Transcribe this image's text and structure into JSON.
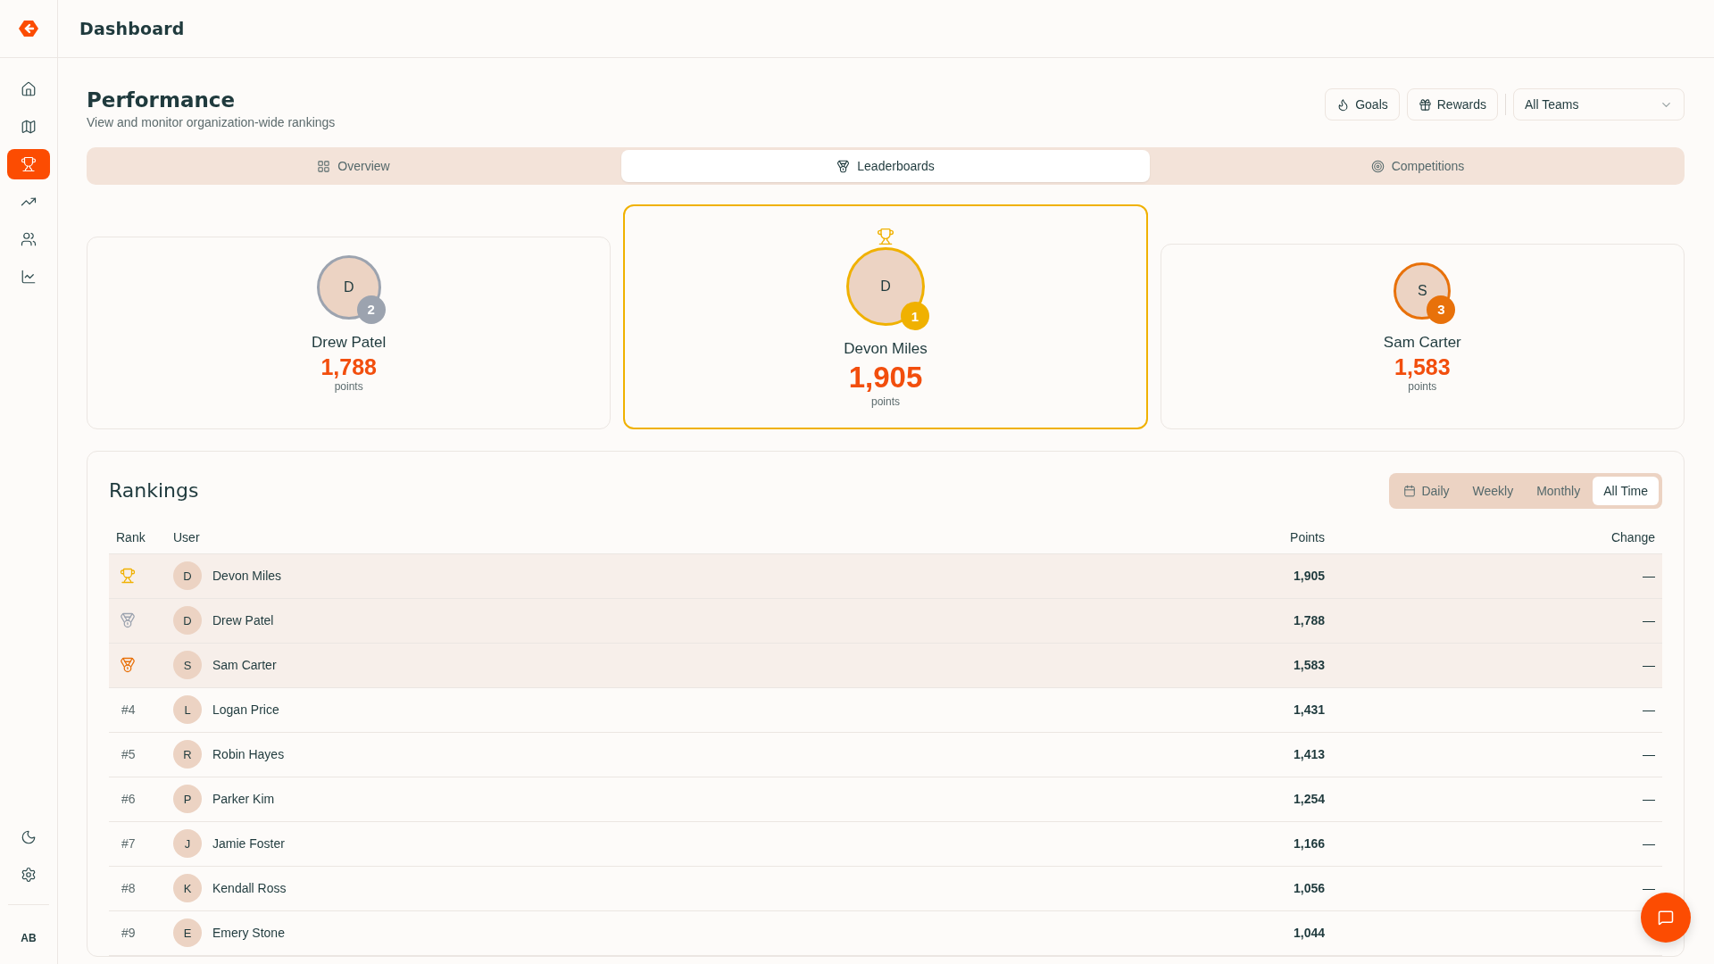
{
  "header": {
    "title": "Dashboard"
  },
  "sidebar": {
    "items": [
      {
        "selected": false
      },
      {
        "selected": false
      },
      {
        "selected": true
      },
      {
        "selected": false
      },
      {
        "selected": false
      },
      {
        "selected": false
      }
    ],
    "user_initials": "AB"
  },
  "page": {
    "title": "Performance",
    "subtitle": "View and monitor organization-wide rankings",
    "buttons": [
      "Goals",
      "Rewards"
    ],
    "team_select": "All Teams"
  },
  "tabs": [
    {
      "label": "Overview",
      "selected": false
    },
    {
      "label": "Leaderboards",
      "selected": true
    },
    {
      "label": "Competitions",
      "selected": false
    }
  ],
  "podium": [
    {
      "kind": "silver",
      "initial": "D",
      "badge": "2",
      "name": "Drew Patel",
      "points": "1,788",
      "unit": "points"
    },
    {
      "kind": "gold",
      "initial": "D",
      "badge": "1",
      "name": "Devon Miles",
      "points": "1,905",
      "unit": "points"
    },
    {
      "kind": "bronze",
      "initial": "S",
      "badge": "3",
      "name": "Sam Carter",
      "points": "1,583",
      "unit": "points"
    }
  ],
  "rankings": {
    "title": "Rankings",
    "periods": [
      {
        "label": "Daily",
        "selected": false
      },
      {
        "label": "Weekly",
        "selected": false
      },
      {
        "label": "Monthly",
        "selected": false
      },
      {
        "label": "All Time",
        "selected": true
      }
    ],
    "columns": [
      "Rank",
      "User",
      "Points",
      "Change"
    ],
    "rows": [
      {
        "kind": "gold",
        "initial": "D",
        "user": "Devon Miles",
        "points": "1,905",
        "change": "—"
      },
      {
        "kind": "silver",
        "initial": "D",
        "user": "Drew Patel",
        "points": "1,788",
        "change": "—"
      },
      {
        "kind": "bronze",
        "initial": "S",
        "user": "Sam Carter",
        "points": "1,583",
        "change": "—"
      },
      {
        "rank": "#4",
        "initial": "L",
        "user": "Logan Price",
        "points": "1,431",
        "change": "—"
      },
      {
        "rank": "#5",
        "initial": "R",
        "user": "Robin Hayes",
        "points": "1,413",
        "change": "—"
      },
      {
        "rank": "#6",
        "initial": "P",
        "user": "Parker Kim",
        "points": "1,254",
        "change": "—"
      },
      {
        "rank": "#7",
        "initial": "J",
        "user": "Jamie Foster",
        "points": "1,166",
        "change": "—"
      },
      {
        "rank": "#8",
        "initial": "K",
        "user": "Kendall Ross",
        "points": "1,056",
        "change": "—"
      },
      {
        "rank": "#9",
        "initial": "E",
        "user": "Emery Stone",
        "points": "1,044"
      }
    ]
  }
}
